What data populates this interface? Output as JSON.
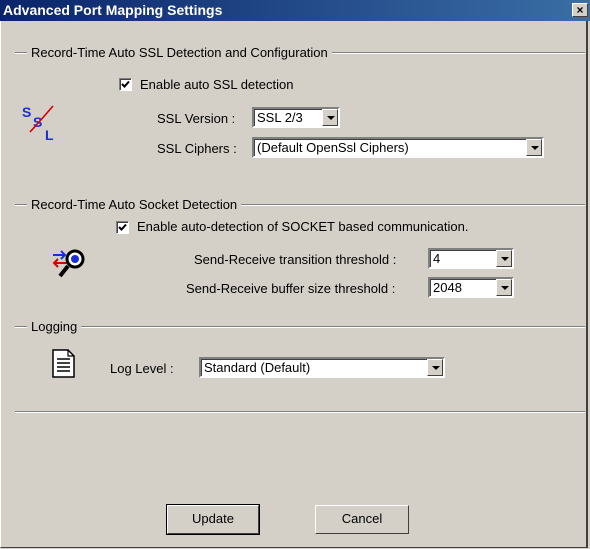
{
  "window": {
    "title": "Advanced Port Mapping Settings",
    "close_glyph": "×"
  },
  "ssl": {
    "group_title": "Record-Time Auto SSL Detection and Configuration",
    "enable_label": "Enable auto SSL detection",
    "enable_checked": true,
    "icon": "ssl-logo-icon",
    "version_label": "SSL Version :",
    "version_value": "SSL 2/3",
    "ciphers_label": "SSL Ciphers :",
    "ciphers_value": "(Default OpenSsl Ciphers)"
  },
  "socket": {
    "group_title": "Record-Time Auto Socket Detection",
    "enable_label": "Enable auto-detection of SOCKET based communication.",
    "enable_checked": true,
    "icon": "socket-detect-icon",
    "transition_label": "Send-Receive transition threshold :",
    "transition_value": "4",
    "buffer_label": "Send-Receive buffer size threshold :",
    "buffer_value": "2048"
  },
  "logging": {
    "group_title": "Logging",
    "icon": "document-icon",
    "level_label": "Log Level :",
    "level_value": "Standard (Default)"
  },
  "buttons": {
    "update": "Update",
    "cancel": "Cancel"
  },
  "colors": {
    "ssl_blue": "#1a2fd6",
    "ssl_red": "#d40000",
    "titlebar": "#0a246a"
  }
}
